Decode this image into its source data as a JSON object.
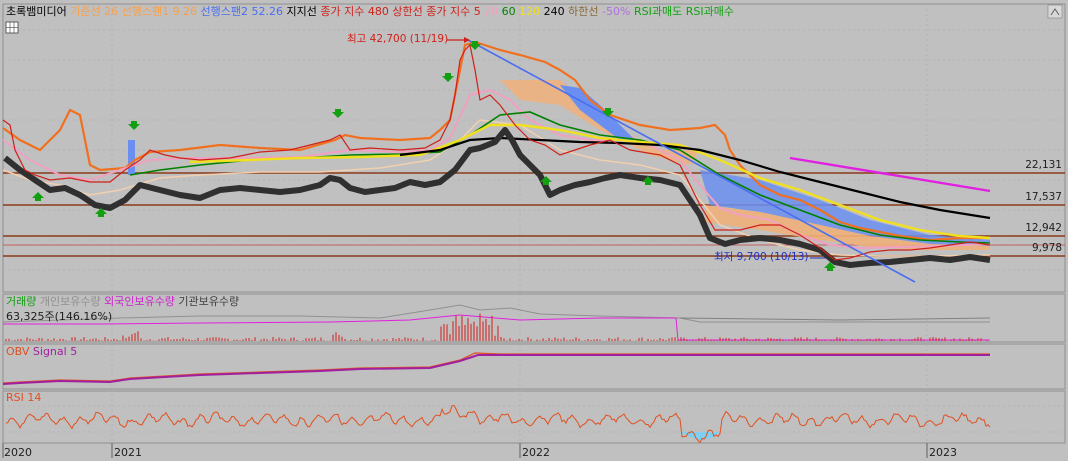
{
  "legend_main": [
    {
      "text": "초록뱀미디어",
      "color": "#000000"
    },
    {
      "text": "기준선 26",
      "color": "#f7a04a"
    },
    {
      "text": "선행스팬1 9.26",
      "color": "#f7a04a"
    },
    {
      "text": "선행스팬2 52.26",
      "color": "#4a6ff0"
    },
    {
      "text": "지지선",
      "color": "#000000"
    },
    {
      "text": "종가 지수 480",
      "color": "#d0201a"
    },
    {
      "text": "상한선",
      "color": "#d0201a"
    },
    {
      "text": "종가 지수 5",
      "color": "#d0201a"
    },
    {
      "text": "20",
      "color": "#f0a0c0"
    },
    {
      "text": "60",
      "color": "#008000"
    },
    {
      "text": "120",
      "color": "#f0e020"
    },
    {
      "text": "240",
      "color": "#000000"
    },
    {
      "text": "하한선",
      "color": "#8a6a3a"
    },
    {
      "text": "-50%",
      "color": "#b070e0"
    },
    {
      "text": "RSI과매도",
      "color": "#12a012"
    },
    {
      "text": "RSI과매수",
      "color": "#12a012"
    }
  ],
  "annotations": {
    "high": "최고 42,700 (11/19)",
    "low": "최저 9,700 (10/13)"
  },
  "price_levels": [
    "22,131",
    "17,537",
    "12,942",
    "9,978"
  ],
  "volume_legend": [
    {
      "text": "거래량",
      "color": "#12a012"
    },
    {
      "text": "개인보유수량",
      "color": "#909090"
    },
    {
      "text": "외국인보유수량",
      "color": "#d020d0"
    },
    {
      "text": "기관보유수량",
      "color": "#404040"
    }
  ],
  "volume_value": "63,325주(146.16%)",
  "obv_legend": [
    {
      "text": "OBV",
      "color": "#e05020"
    },
    {
      "text": "Signal 5",
      "color": "#a020a0"
    }
  ],
  "rsi_legend": [
    {
      "text": "RSI 14",
      "color": "#e05020"
    }
  ],
  "x_axis_labels": [
    "2020",
    "2021",
    "2022",
    "2023"
  ],
  "colors": {
    "bg": "#c0c0c0",
    "bollinger": "#f07020",
    "cloud_blue": "#6b8ff0",
    "ma120": "#f0e020",
    "ma240": "#000000",
    "support": "#404040",
    "trendline": "#4a6ff0",
    "level_line": "#8b3a1a"
  }
}
